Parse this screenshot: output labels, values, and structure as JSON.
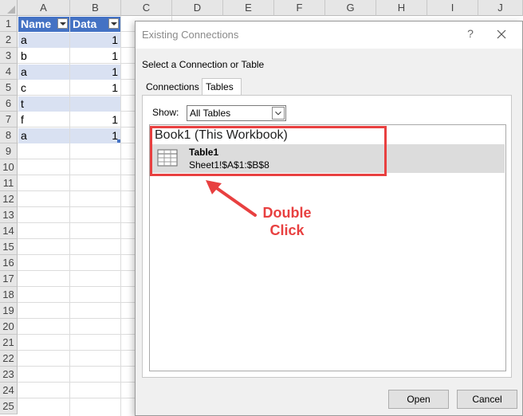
{
  "columns": [
    "A",
    "B",
    "C",
    "D",
    "E",
    "F",
    "G",
    "H",
    "I",
    "J"
  ],
  "rows": [
    "1",
    "2",
    "3",
    "4",
    "5",
    "6",
    "7",
    "8",
    "9",
    "10",
    "11",
    "12",
    "13",
    "14",
    "15",
    "16",
    "17",
    "18",
    "19",
    "20",
    "21",
    "22",
    "23",
    "24",
    "25"
  ],
  "table": {
    "headers": [
      "Name",
      "Data"
    ],
    "records": [
      {
        "name": "a",
        "data": "1"
      },
      {
        "name": "b",
        "data": "1"
      },
      {
        "name": "a",
        "data": "1"
      },
      {
        "name": "c",
        "data": "1"
      },
      {
        "name": "t",
        "data": ""
      },
      {
        "name": "f",
        "data": "1"
      },
      {
        "name": "a",
        "data": "1"
      }
    ]
  },
  "dialog": {
    "title": "Existing Connections",
    "help": "?",
    "subtitle": "Select a Connection or Table",
    "tabs": [
      "Connections",
      "Tables"
    ],
    "active_tab": "Tables",
    "show_label": "Show:",
    "show_value": "All Tables",
    "group": "Book1 (This Workbook)",
    "item": {
      "name": "Table1",
      "ref": "Sheet1!$A$1:$B$8",
      "icon": "table-icon"
    },
    "open_label": "Open",
    "cancel_label": "Cancel"
  },
  "annotation": {
    "line1": "Double",
    "line2": "Click"
  },
  "colors": {
    "table_header": "#4472c4",
    "band": "#d9e1f2",
    "annotation": "#e84040"
  }
}
